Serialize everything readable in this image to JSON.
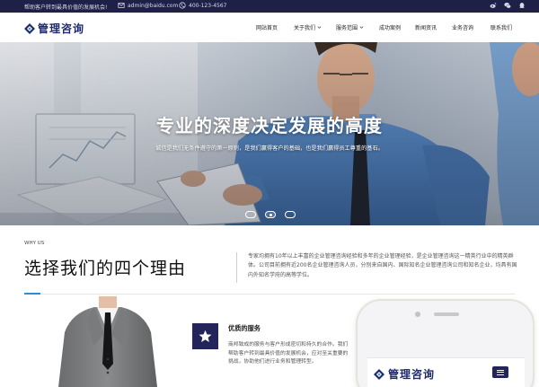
{
  "topbar": {
    "slogan": "帮助客户转到最具价值的发展机会!",
    "email": "admin@baidu.com",
    "phone": "400-123-4567",
    "socials": [
      "weibo-icon",
      "wechat-icon",
      "qq-icon"
    ]
  },
  "logo": {
    "text": "管理咨询"
  },
  "nav": {
    "items": [
      {
        "label": "网站首页",
        "has_dropdown": false
      },
      {
        "label": "关于我们",
        "has_dropdown": true
      },
      {
        "label": "服务范围",
        "has_dropdown": true
      },
      {
        "label": "成功案例",
        "has_dropdown": false
      },
      {
        "label": "新闻资讯",
        "has_dropdown": false
      },
      {
        "label": "业务咨询",
        "has_dropdown": false
      },
      {
        "label": "联系我们",
        "has_dropdown": false
      }
    ]
  },
  "hero": {
    "title": "专业的深度决定发展的高度",
    "subtitle": "诚信是我们无条件遵守的第一原则，是我们赢得客户的基础，也是我们赢得员工尊重的基石。",
    "slides": 3,
    "active_slide": 2
  },
  "why": {
    "eyebrow": "WHY US",
    "title": "选择我们的四个理由",
    "description": "专家均拥有10年以上丰富的企业管理咨询经验和多年的企业管理经验，是企业管理咨询这一精英行业中的精英群体。公司目前拥有近200名企业管理咨询人员，分别来自国内、国际知名企业管理咨询公司和知名企业，均具有国内外知名学府的高等学位。"
  },
  "service": {
    "title": "优质的服务",
    "text": "商邦致成的服务与客户形成密切和持久的合作。我们帮助客户转到最具价值的发展机会，应对至关重要的挑战，协助他们进行业务和管理转型。"
  },
  "phone_mock": {
    "logo_text": "管理咨询"
  },
  "colors": {
    "navy": "#1f2047",
    "accent": "#2e8bd6",
    "icon_bg": "#23255a"
  }
}
